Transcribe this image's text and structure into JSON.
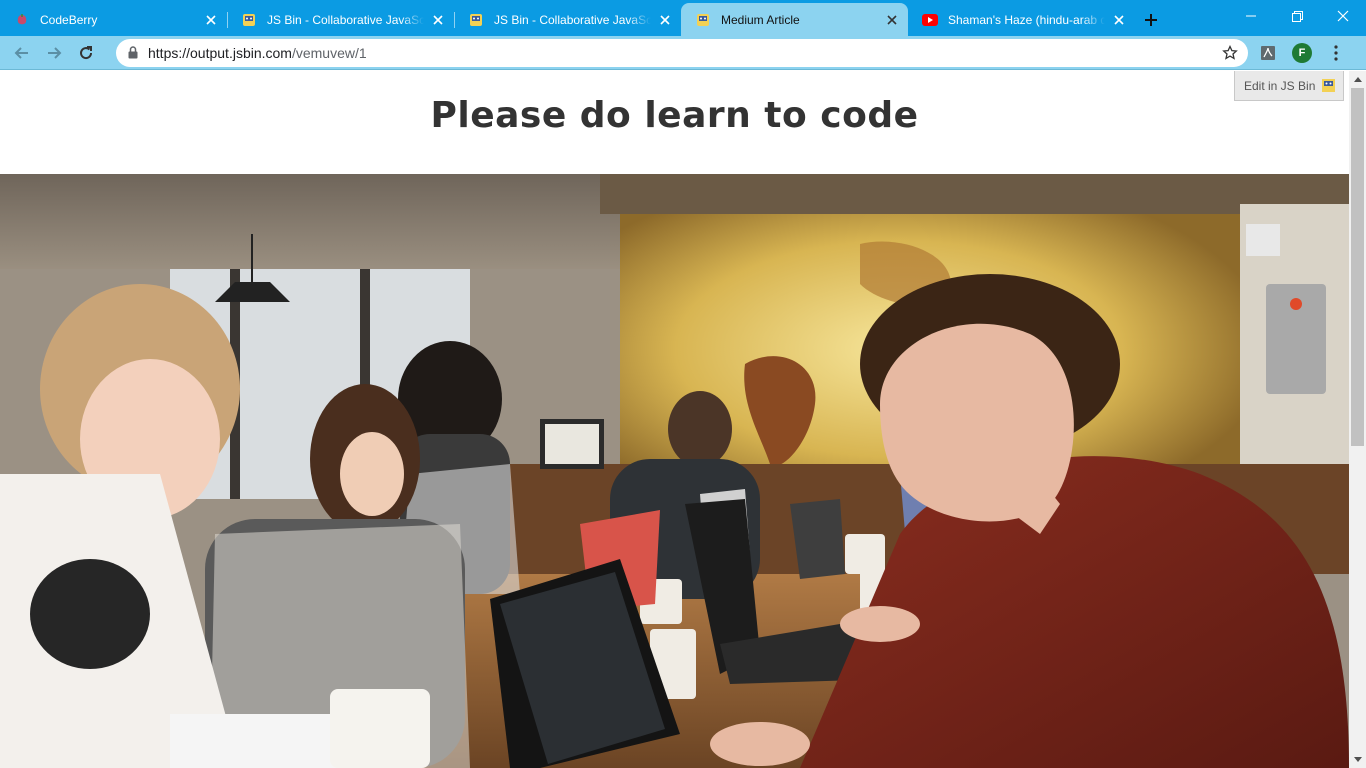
{
  "browser": {
    "tabs": [
      {
        "title": "CodeBerry",
        "favicon": "codeberry-icon",
        "active": false
      },
      {
        "title": "JS Bin - Collaborative JavaScript Debugging",
        "favicon": "jsbin-icon",
        "active": false
      },
      {
        "title": "JS Bin - Collaborative JavaScript Debugging",
        "favicon": "jsbin-icon",
        "active": false
      },
      {
        "title": "Medium Article",
        "favicon": "jsbin-icon",
        "active": true
      },
      {
        "title": "Shaman's Haze (hindu-arab dub)",
        "favicon": "youtube-icon",
        "active": false
      }
    ],
    "url": {
      "host": "https://output.jsbin.com",
      "path": "/vemuvew/1"
    },
    "profile_initial": "F",
    "colors": {
      "frame": "#0b9be3",
      "toolbar": "#8cd3f0"
    }
  },
  "page": {
    "heading": "Please do learn to code",
    "edit_in_jsbin": "Edit in JS Bin",
    "image_subject": "people coding on laptops in a cafe"
  }
}
